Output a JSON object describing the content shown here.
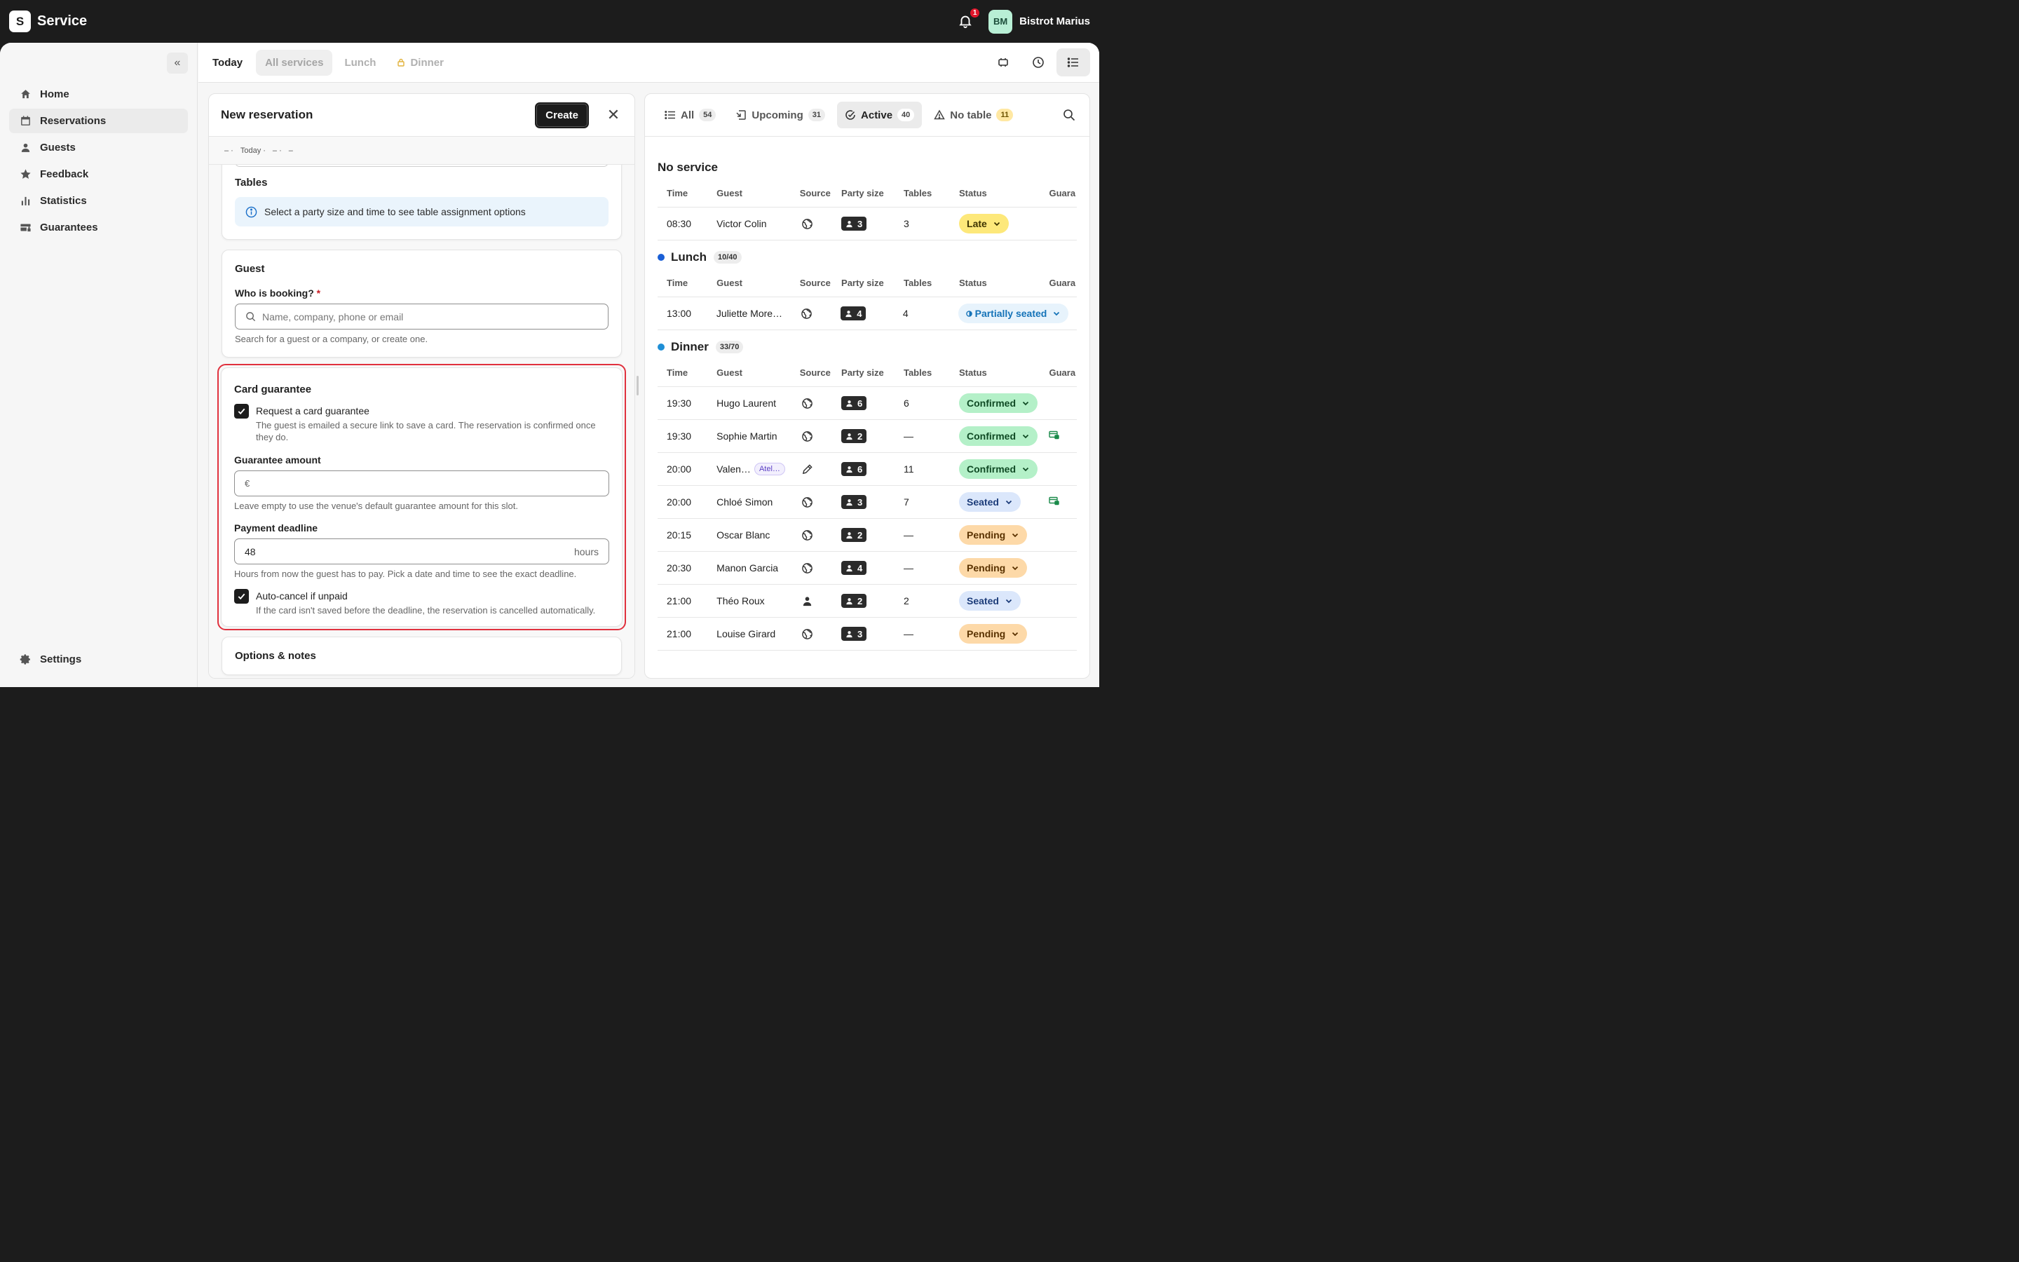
{
  "app": {
    "logo_letter": "S",
    "name": "Service",
    "notification_count": "1",
    "user_initials": "BM",
    "venue_name": "Bistrot Marius"
  },
  "sidebar": {
    "items": [
      {
        "label": "Home",
        "icon": "home-icon",
        "active": false
      },
      {
        "label": "Reservations",
        "icon": "calendar-icon",
        "active": true
      },
      {
        "label": "Guests",
        "icon": "person-icon",
        "active": false
      },
      {
        "label": "Feedback",
        "icon": "star-icon",
        "active": false
      },
      {
        "label": "Statistics",
        "icon": "bar-chart-icon",
        "active": false
      },
      {
        "label": "Guarantees",
        "icon": "card-icon",
        "active": false
      }
    ],
    "settings_label": "Settings"
  },
  "toolbar": {
    "today": "Today",
    "tabs": [
      "All services",
      "Lunch",
      "Dinner"
    ]
  },
  "new_reservation": {
    "title": "New reservation",
    "create_label": "Create",
    "summary": [
      "– ·",
      "Today ·",
      "– ·",
      "–"
    ],
    "tables": {
      "title": "Tables",
      "info": "Select a party size and time to see table assignment options"
    },
    "guest": {
      "title": "Guest",
      "label": "Who is booking?",
      "required_mark": "*",
      "placeholder": "Name, company, phone or email",
      "help": "Search for a guest or a company, or create one."
    },
    "card_guarantee": {
      "title": "Card guarantee",
      "request_label": "Request a card guarantee",
      "request_desc": "The guest is emailed a secure link to save a card. The reservation is confirmed once they do.",
      "request_checked": true,
      "amount_label": "Guarantee amount",
      "amount_prefix": "€",
      "amount_value": "",
      "amount_help": "Leave empty to use the venue's default guarantee amount for this slot.",
      "deadline_label": "Payment deadline",
      "deadline_value": "48",
      "deadline_suffix": "hours",
      "deadline_help": "Hours from now the guest has to pay. Pick a date and time to see the exact deadline.",
      "autocancel_label": "Auto-cancel if unpaid",
      "autocancel_desc": "If the card isn't saved before the deadline, the reservation is cancelled automatically.",
      "autocancel_checked": true
    },
    "options_title": "Options & notes"
  },
  "list": {
    "tabs": [
      {
        "label": "All",
        "count": "54",
        "icon": "list-icon"
      },
      {
        "label": "Upcoming",
        "count": "31",
        "icon": "arrival-icon"
      },
      {
        "label": "Active",
        "count": "40",
        "icon": "check-circle-icon"
      },
      {
        "label": "No table",
        "count": "11",
        "icon": "warning-icon"
      }
    ],
    "headers": [
      "Time",
      "Guest",
      "Source",
      "Party size",
      "Tables",
      "Status",
      "Guara"
    ],
    "sections": [
      {
        "title": "No service",
        "capacity": "",
        "dot_color": "",
        "rows": [
          {
            "time": "08:30",
            "guest": "Victor Colin",
            "tag": "",
            "source": "globe",
            "party": "3",
            "tables": "3",
            "status": "Late",
            "status_kind": "late",
            "guarantee": false
          }
        ]
      },
      {
        "title": "Lunch",
        "capacity": "10/40",
        "dot_color": "#1a5fd6",
        "rows": [
          {
            "time": "13:00",
            "guest": "Juliette More…",
            "tag": "",
            "source": "globe",
            "party": "4",
            "tables": "4",
            "status": "Partially seated",
            "status_kind": "partial",
            "guarantee": false
          }
        ]
      },
      {
        "title": "Dinner",
        "capacity": "33/70",
        "dot_color": "#1f8fd6",
        "rows": [
          {
            "time": "19:30",
            "guest": "Hugo Laurent",
            "tag": "",
            "source": "globe",
            "party": "6",
            "tables": "6",
            "status": "Confirmed",
            "status_kind": "confirmed",
            "guarantee": false
          },
          {
            "time": "19:30",
            "guest": "Sophie Martin",
            "tag": "",
            "source": "globe",
            "party": "2",
            "tables": "—",
            "status": "Confirmed",
            "status_kind": "confirmed",
            "guarantee": true
          },
          {
            "time": "20:00",
            "guest": "Valen…",
            "tag": "Atel…",
            "source": "pencil",
            "party": "6",
            "tables": "11",
            "status": "Confirmed",
            "status_kind": "confirmed",
            "guarantee": false
          },
          {
            "time": "20:00",
            "guest": "Chloé Simon",
            "tag": "",
            "source": "globe",
            "party": "3",
            "tables": "7",
            "status": "Seated",
            "status_kind": "seated",
            "guarantee": true
          },
          {
            "time": "20:15",
            "guest": "Oscar Blanc",
            "tag": "",
            "source": "globe",
            "party": "2",
            "tables": "—",
            "status": "Pending",
            "status_kind": "pending",
            "guarantee": false
          },
          {
            "time": "20:30",
            "guest": "Manon Garcia",
            "tag": "",
            "source": "globe",
            "party": "4",
            "tables": "—",
            "status": "Pending",
            "status_kind": "pending",
            "guarantee": false
          },
          {
            "time": "21:00",
            "guest": "Théo Roux",
            "tag": "",
            "source": "person",
            "party": "2",
            "tables": "2",
            "status": "Seated",
            "status_kind": "seated",
            "guarantee": false
          },
          {
            "time": "21:00",
            "guest": "Louise Girard",
            "tag": "",
            "source": "globe",
            "party": "3",
            "tables": "—",
            "status": "Pending",
            "status_kind": "pending",
            "guarantee": false
          }
        ]
      }
    ]
  },
  "colors": {
    "late_bg": "#fde87a",
    "late_fg": "#3d3300",
    "partial_bg": "#e7f3fc",
    "partial_fg": "#1573b8",
    "confirmed_bg": "#b4f0c8",
    "confirmed_fg": "#0f4a24",
    "seated_bg": "#dbe7fb",
    "seated_fg": "#1d3d7a",
    "pending_bg": "#fdd9a8",
    "pending_fg": "#5a3200",
    "highlight": "#e0313e"
  }
}
